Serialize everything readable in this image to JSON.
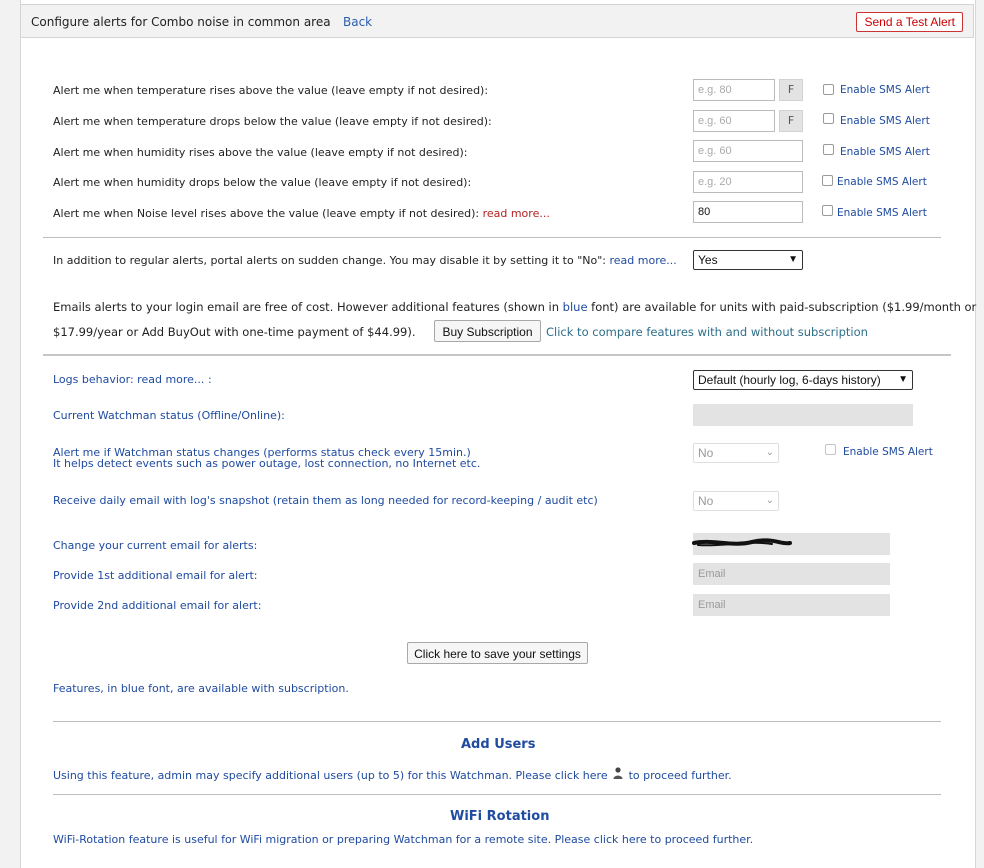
{
  "header": {
    "title": "Configure alerts for Combo noise in common area",
    "back": "Back",
    "test_alert": "Send a Test Alert"
  },
  "alerts": [
    {
      "label": "Alert me when temperature rises above the value (leave empty if not desired):",
      "placeholder": "e.g. 80",
      "value": "",
      "unit": "F",
      "sms": "Enable SMS Alert"
    },
    {
      "label": "Alert me when temperature drops below the value (leave empty if not desired):",
      "placeholder": "e.g. 60",
      "value": "",
      "unit": "F",
      "sms": "Enable SMS Alert"
    },
    {
      "label": "Alert me when humidity rises above the value (leave empty if not desired):",
      "placeholder": "e.g. 60",
      "value": "",
      "unit": "",
      "sms": "Enable SMS Alert"
    },
    {
      "label": "Alert me when humidity drops below the value (leave empty if not desired):",
      "placeholder": "e.g. 20",
      "value": "",
      "unit": "",
      "sms": "Enable SMS Alert"
    },
    {
      "label": "Alert me when Noise level rises above the value (leave empty if not desired):",
      "read_more": "read more...",
      "placeholder": "",
      "value": "80",
      "unit": "",
      "sms": "Enable SMS Alert"
    }
  ],
  "sudden_change": {
    "label": "In addition to regular alerts, portal alerts on sudden change. You may disable it by setting it to \"No\":",
    "read_more": "read more...",
    "value": "Yes"
  },
  "subscription": {
    "text_part1": "Emails alerts to your login email are free of cost. However additional features (shown in",
    "blue_word": "blue",
    "text_part2": "font) are available for units with paid-subscription ($1.99/month or",
    "text_line2": "$17.99/year or Add BuyOut with one-time payment of $44.99).",
    "button": "Buy Subscription",
    "compare_link": "Click to compare features with and without subscription"
  },
  "logs": {
    "label": "Logs behavior:",
    "read_more": "read more...",
    "suffix": ":",
    "value": "Default (hourly log, 6-days history)"
  },
  "status": {
    "label": "Current Watchman status (Offline/Online):",
    "value": ""
  },
  "status_change": {
    "label_line1": "Alert me if Watchman status changes (performs status check every 15min.)",
    "label_line2": "It helps detect events such as power outage, lost connection, no Internet etc.",
    "value": "No",
    "sms": "Enable SMS Alert"
  },
  "daily_email": {
    "label": "Receive daily email with log's snapshot  (retain them as long needed for record-keeping / audit etc)",
    "value": "No"
  },
  "emails": {
    "current_label": "Change your current email for alerts:",
    "first_label": "Provide 1st additional email for alert:",
    "first_placeholder": "Email",
    "second_label": "Provide 2nd additional email for alert:",
    "second_placeholder": "Email"
  },
  "save_button": "Click here to save your settings",
  "features_note": "Features, in blue font, are available with subscription.",
  "add_users": {
    "title": "Add Users",
    "text_before": "Using this feature, admin may specify additional users (up to 5) for this Watchman. Please",
    "link": "click here",
    "icon": "user-icon",
    "text_after": "to proceed further."
  },
  "wifi_rotation": {
    "title": "WiFi Rotation",
    "text_before": "WiFi-Rotation feature is useful for WiFi migration or preparing Watchman for a remote site. Please",
    "link": "click here",
    "text_after": "to proceed further."
  }
}
